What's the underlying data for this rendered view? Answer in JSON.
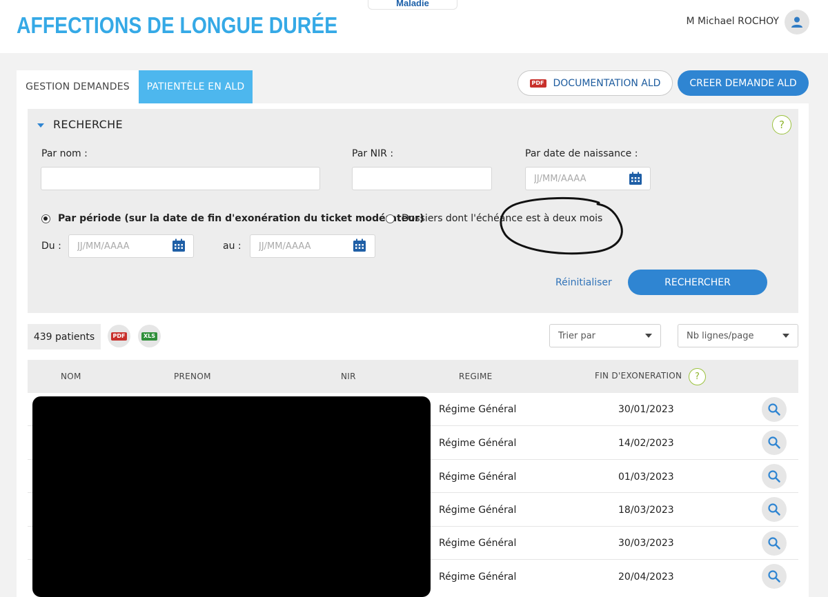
{
  "header": {
    "app_title": "AFFECTIONS DE LONGUE DURÉE",
    "top_tab_label": "Maladie",
    "user_name": "M Michael ROCHOY",
    "avatar_icon": "user-icon"
  },
  "tabs": [
    {
      "label": "GESTION DEMANDES",
      "active": false
    },
    {
      "label": "PATIENTÈLE EN ALD",
      "active": true
    }
  ],
  "actions": {
    "documentation_label": "DOCUMENTATION ALD",
    "documentation_badge": "PDF",
    "create_label": "CREER DEMANDE ALD"
  },
  "search": {
    "title": "RECHERCHE",
    "help": "?",
    "name_label": "Par nom :",
    "name_value": "",
    "nir_label": "Par NIR :",
    "nir_value": "",
    "birthdate_label": "Par date de naissance :",
    "birthdate_placeholder": "JJ/MM/AAAA",
    "radio_period_label": "Par période (sur la date de fin d'exonération du ticket modérateur)",
    "radio_period_checked": true,
    "radio_deadline_label": "Dossiers dont l'échéance est à deux mois",
    "radio_deadline_checked": false,
    "from_label": "Du :",
    "from_placeholder": "JJ/MM/AAAA",
    "to_label": "au :",
    "to_placeholder": "JJ/MM/AAAA",
    "reset_label": "Réinitialiser",
    "search_label": "RECHERCHER"
  },
  "results": {
    "count_label": "439 patients",
    "pdf_badge": "PDF",
    "xls_badge": "XLS",
    "sort_label": "Trier par",
    "rows_per_page_label": "Nb lignes/page"
  },
  "table": {
    "headers": [
      "NOM",
      "PRENOM",
      "NIR",
      "REGIME",
      "FIN D'EXONERATION"
    ],
    "header_help": "?",
    "rows": [
      {
        "regime": "Régime Général",
        "fin": "30/01/2023"
      },
      {
        "regime": "Régime Général",
        "fin": "14/02/2023"
      },
      {
        "regime": "Régime Général",
        "fin": "01/03/2023"
      },
      {
        "regime": "Régime Général",
        "fin": "18/03/2023"
      },
      {
        "regime": "Régime Général",
        "fin": "30/03/2023"
      },
      {
        "regime": "Régime Général",
        "fin": "20/04/2023"
      }
    ]
  },
  "colors": {
    "brand_blue": "#35a9e6",
    "active_tab": "#4db7ee",
    "primary_button": "#2f85d2",
    "help_green": "#9bc23d"
  }
}
